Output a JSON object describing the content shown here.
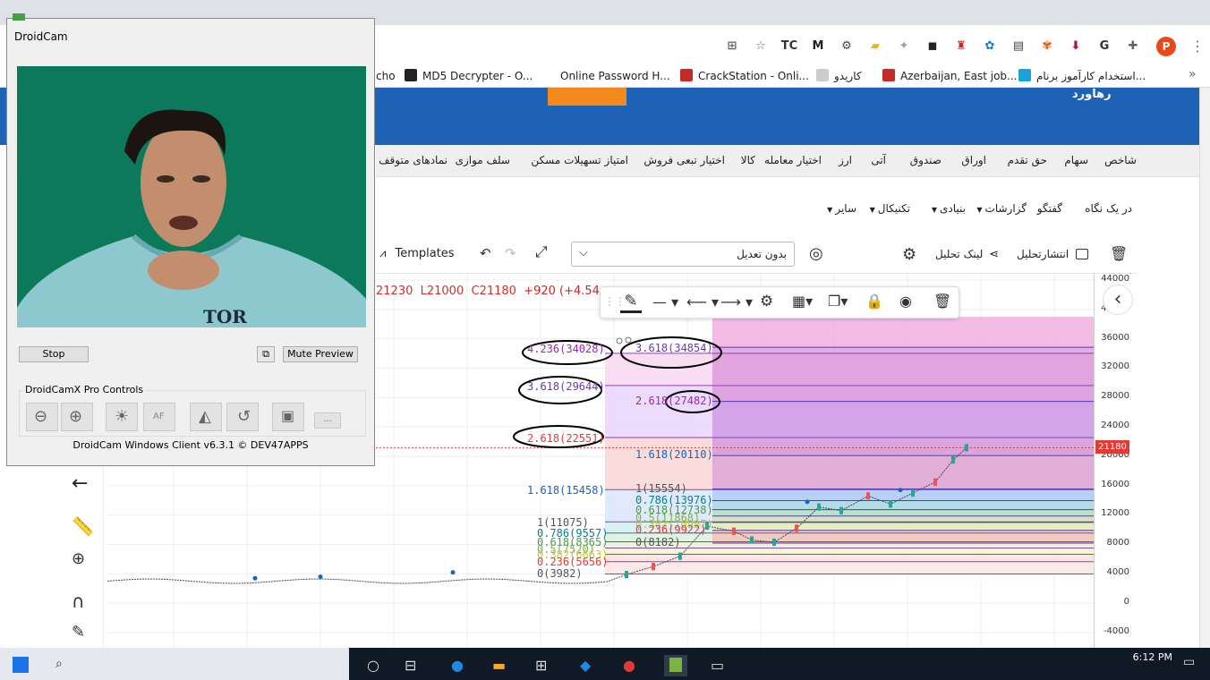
{
  "browser": {
    "bookmarks": [
      {
        "label": "cho",
        "color": "#ffffff"
      },
      {
        "label": "MD5 Decrypter - O...",
        "color": "#222222"
      },
      {
        "label": "Online Password H...",
        "color": "#ffffff"
      },
      {
        "label": "CrackStation - Onli...",
        "color": "#c62828"
      },
      {
        "label": "کاریدو",
        "color": "#cccccc"
      },
      {
        "label": "Azerbaijan, East job...",
        "color": "#c62828"
      },
      {
        "label": "استخدام کارآموز برنام...",
        "color": "#1aa3d6"
      }
    ],
    "bookmarks_more": "»",
    "profile_initial": "P",
    "extensions": [
      {
        "name": "translate-icon",
        "glyph": "⊞",
        "color": "#5f6368"
      },
      {
        "name": "star-icon",
        "glyph": "☆",
        "color": "#5f6368"
      },
      {
        "name": "tc-extension-icon",
        "glyph": "TC",
        "color": "#333333"
      },
      {
        "name": "m-extension-icon",
        "glyph": "M",
        "color": "#222222"
      },
      {
        "name": "gear-extension-icon",
        "glyph": "⚙",
        "color": "#444444"
      },
      {
        "name": "folder-extension-icon",
        "glyph": "▰",
        "color": "#f4b400"
      },
      {
        "name": "shield-extension-icon",
        "glyph": "✦",
        "color": "#9e9e9e"
      },
      {
        "name": "vpn-extension-icon",
        "glyph": "◼",
        "color": "#222222"
      },
      {
        "name": "alarm-extension-icon",
        "glyph": "♜",
        "color": "#c62828"
      },
      {
        "name": "settings-extension-icon",
        "glyph": "✿",
        "color": "#1976d2"
      },
      {
        "name": "news-extension-icon",
        "glyph": "▤",
        "color": "#444444"
      },
      {
        "name": "flower-extension-icon",
        "glyph": "✾",
        "color": "#e65100"
      },
      {
        "name": "download-extension-icon",
        "glyph": "⬇",
        "color": "#ad1457"
      },
      {
        "name": "g-extension-icon",
        "glyph": "G",
        "color": "#333333"
      },
      {
        "name": "puzzle-icon",
        "glyph": "✚",
        "color": "#5f6368"
      }
    ]
  },
  "site": {
    "logo": "رهاورد",
    "nav": [
      "شاخص",
      "سهام",
      "حق تقدم",
      "اوراق",
      "صندوق",
      "آتی",
      "ارز",
      "اختیار معامله",
      "کالا",
      "اختیار تبعی فروش",
      "امتیاز تسهیلات مسکن",
      "سلف موازی",
      "نمادهای متوقف شده"
    ],
    "subnav": [
      "در یک نگاه",
      "گفتگو",
      "گزارشات",
      "بنیادی",
      "تکنیکال",
      "سایر"
    ]
  },
  "chart_toolbar": {
    "publish": "انتشارتحلیل",
    "link": "لینک تحلیل",
    "adjustment": "بدون تعدیل",
    "templates": "Templates"
  },
  "ohlc": {
    "high": "21230",
    "low": "L21000",
    "close": "C21180",
    "change": "+920 (+4.54"
  },
  "price_axis": {
    "ticks": [
      "44000",
      "40000",
      "36000",
      "32000",
      "28000",
      "24000",
      "20000",
      "16000",
      "12000",
      "8000",
      "4000",
      "0",
      "-4000"
    ],
    "last_price": "21180",
    "last_price_color": "#e53935"
  },
  "fib_left": {
    "levels": [
      {
        "label": "4.236(34028)",
        "color": "#9c27b0"
      },
      {
        "label": "3.618(29644)",
        "color": "#673ab7"
      },
      {
        "label": "2.618(22551)",
        "color": "#e53935"
      },
      {
        "label": "1.618(15458)",
        "color": "#1565c0"
      },
      {
        "label": "1(11075)",
        "color": "#555555"
      },
      {
        "label": "0.786(9557)",
        "color": "#00838f"
      },
      {
        "label": "0.618(8365)",
        "color": "#43a047"
      },
      {
        "label": "0.5(7520)",
        "color": "#7cb342"
      },
      {
        "label": "0.382(6663)",
        "color": "#c0ca33"
      },
      {
        "label": "0.236(5656)",
        "color": "#e53935"
      },
      {
        "label": "0(3982)",
        "color": "#555555"
      }
    ]
  },
  "fib_right": {
    "levels": [
      {
        "label": "3.618(34854)",
        "color": "#673ab7"
      },
      {
        "label": "2.618(27482)",
        "color": "#9c27b0"
      },
      {
        "label": "1.618(20110)",
        "color": "#1565c0"
      },
      {
        "label": "1(15554)",
        "color": "#555555"
      },
      {
        "label": "0.786(13976)",
        "color": "#00838f"
      },
      {
        "label": "0.618(12738)",
        "color": "#43a047"
      },
      {
        "label": "0.5(11868)",
        "color": "#7cb342"
      },
      {
        "label": "0.382(10997)",
        "color": "#c0ca33"
      },
      {
        "label": "0.236(9922)",
        "color": "#e53935"
      },
      {
        "label": "0(8182)",
        "color": "#555555"
      }
    ]
  },
  "droidcam": {
    "title": "DroidCam",
    "stop": "Stop",
    "mute_preview": "Mute Preview",
    "pro_controls": "DroidCamX Pro Controls",
    "af": "AF",
    "more": "...",
    "footer": "DroidCam Windows Client v6.3.1 © DEV47APPS",
    "shirt_text": "TOR",
    "background_color": "#0c7a5a"
  },
  "taskbar": {
    "time": "6:12 PM"
  },
  "watermark": "apa"
}
